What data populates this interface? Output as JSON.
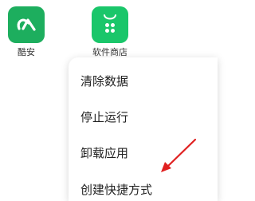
{
  "desktop": {
    "apps": [
      {
        "label": "酷安",
        "icon": "coolapk-icon",
        "color": "#1dae5e"
      },
      {
        "label": "软件商店",
        "icon": "app-store-icon",
        "color": "#1ac66a"
      }
    ]
  },
  "context_menu": {
    "items": [
      {
        "label": "清除数据"
      },
      {
        "label": "停止运行"
      },
      {
        "label": "卸载应用"
      },
      {
        "label": "创建快捷方式"
      }
    ]
  },
  "annotation": {
    "color": "#e02020"
  }
}
